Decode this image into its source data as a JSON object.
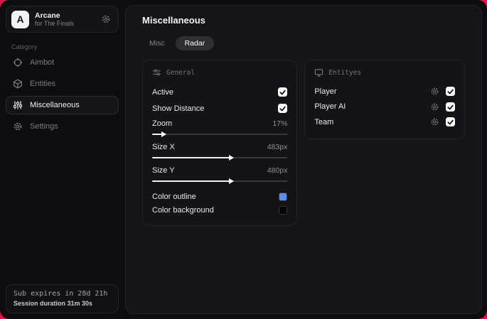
{
  "backdrop_color": "#dd1747",
  "app": {
    "logo_letter": "A",
    "name": "Arcane",
    "subtitle": "for The Finals"
  },
  "sidebar": {
    "category_label": "Category",
    "items": [
      {
        "label": "Aimbot",
        "icon": "crosshair-icon",
        "active": false
      },
      {
        "label": "Entities",
        "icon": "cube-icon",
        "active": false
      },
      {
        "label": "Miscellaneous",
        "icon": "sliders-vertical-icon",
        "active": true
      },
      {
        "label": "Settings",
        "icon": "gear-icon",
        "active": false
      }
    ],
    "footer": {
      "line1": "Sub expires in 28d 21h",
      "line2": "Session duration 31m 30s"
    }
  },
  "main": {
    "title": "Miscellaneous",
    "tabs": [
      {
        "label": "Misc",
        "active": false
      },
      {
        "label": "Radar",
        "active": true
      }
    ],
    "general_card": {
      "title": "General",
      "icon": "sliders-horizontal-icon",
      "toggles": [
        {
          "label": "Active",
          "checked": true
        },
        {
          "label": "Show Distance",
          "checked": true
        }
      ],
      "sliders": [
        {
          "label": "Zoom",
          "value": "17%",
          "percent": 8
        },
        {
          "label": "Size X",
          "value": "483px",
          "percent": 58
        },
        {
          "label": "Size Y",
          "value": "480px",
          "percent": 58
        }
      ],
      "colors": [
        {
          "label": "Color outline",
          "swatch": "#5b8def"
        },
        {
          "label": "Color background",
          "swatch": "#050505"
        }
      ]
    },
    "entities_card": {
      "title": "Entityes",
      "icon": "monitor-icon",
      "rows": [
        {
          "label": "Player",
          "checked": true
        },
        {
          "label": "Player AI",
          "checked": true
        },
        {
          "label": "Team",
          "checked": true
        }
      ]
    }
  }
}
